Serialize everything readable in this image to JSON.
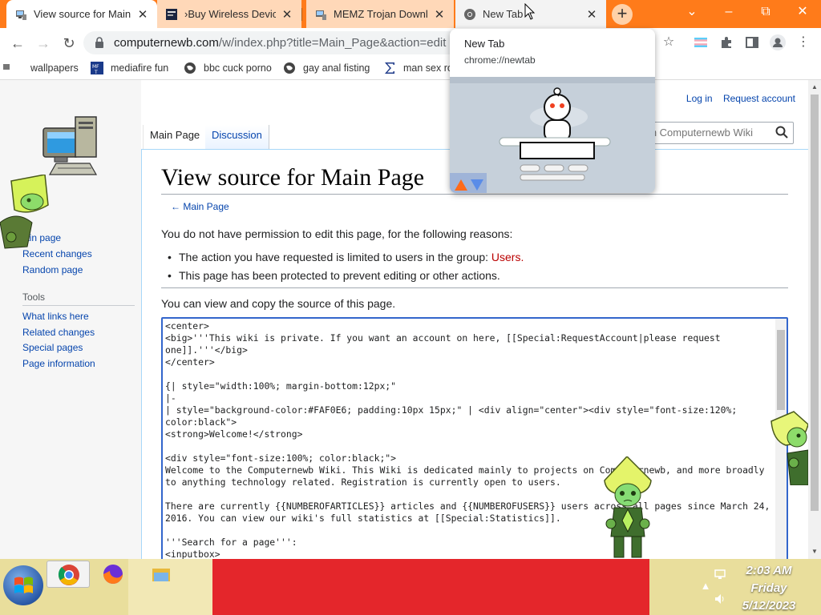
{
  "browser": {
    "tabs": [
      {
        "title": "View source for Main",
        "state": "active"
      },
      {
        "title": "›Buy Wireless Device",
        "state": "background"
      },
      {
        "title": "MEMZ Trojan Downlo",
        "state": "background"
      },
      {
        "title": "New Tab",
        "state": "hovered"
      }
    ],
    "new_tab_symbol": "+",
    "window_controls": {
      "dropdown": "⌄",
      "minimize": "–",
      "maximize": "⧉",
      "close": "✕"
    },
    "url_host": "computernewb.com",
    "url_path": "/w/index.php?title=Main_Page&action=edit",
    "bookmarks": [
      "wallpapers",
      "mediafire fun",
      "bbc cuck porno",
      "gay anal fisting",
      "man sex ro"
    ],
    "hover_card": {
      "title": "New Tab",
      "url": "chrome://newtab"
    }
  },
  "wiki": {
    "user_links": {
      "login": "Log in",
      "request": "Request account"
    },
    "page_tabs": {
      "main": "Main Page",
      "discussion": "Discussion"
    },
    "search_placeholder": "rch Computernewb Wiki",
    "sidebar": {
      "nav": [
        "ain page",
        "Recent changes",
        "Random page"
      ],
      "tools_heading": "Tools",
      "tools": [
        "What links here",
        "Related changes",
        "Special pages",
        "Page information"
      ]
    },
    "title": "View source for Main Page",
    "back_link": "← Main Page",
    "permission_text": "You do not have permission to edit this page, for the following reasons:",
    "reason_1_prefix": "The action you have requested is limited to users in the group: ",
    "reason_1_group": "Users.",
    "reason_2": "This page has been protected to prevent editing or other actions.",
    "view_copy_text": "You can view and copy the source of this page.",
    "source_code": "<center>\n<big>'''This wiki is private. If you want an account on here, [[Special:RequestAccount|please request one]].'''</big>\n</center>\n\n{| style=\"width:100%; margin-bottom:12px;\"\n|-\n| style=\"background-color:#FAF0E6; padding:10px 15px;\" | <div align=\"center\"><div style=\"font-size:120%; color:black\">\n<strong>Welcome!</strong>\n\n<div style=\"font-size:100%; color:black;\">\nWelcome to the Computernewb Wiki. This Wiki is dedicated mainly to projects on Computernewb, and more broadly to anything technology related. Registration is currently open to users.\n\nThere are currently {{NUMBEROFARTICLES}} articles and {{NUMBEROFUSERS}} users across all pages since March 24, 2016. You can view our wiki's full statistics at [[Special:Statistics]].\n\n'''Search for a page''':\n<inputbox>"
  },
  "taskbar": {
    "time": "2:03 AM",
    "day": "Friday",
    "date": "5/12/2023"
  },
  "colors": {
    "tabstrip": "#ff7b1a",
    "link": "#0645ad",
    "taskbar_red": "#e4262b"
  }
}
